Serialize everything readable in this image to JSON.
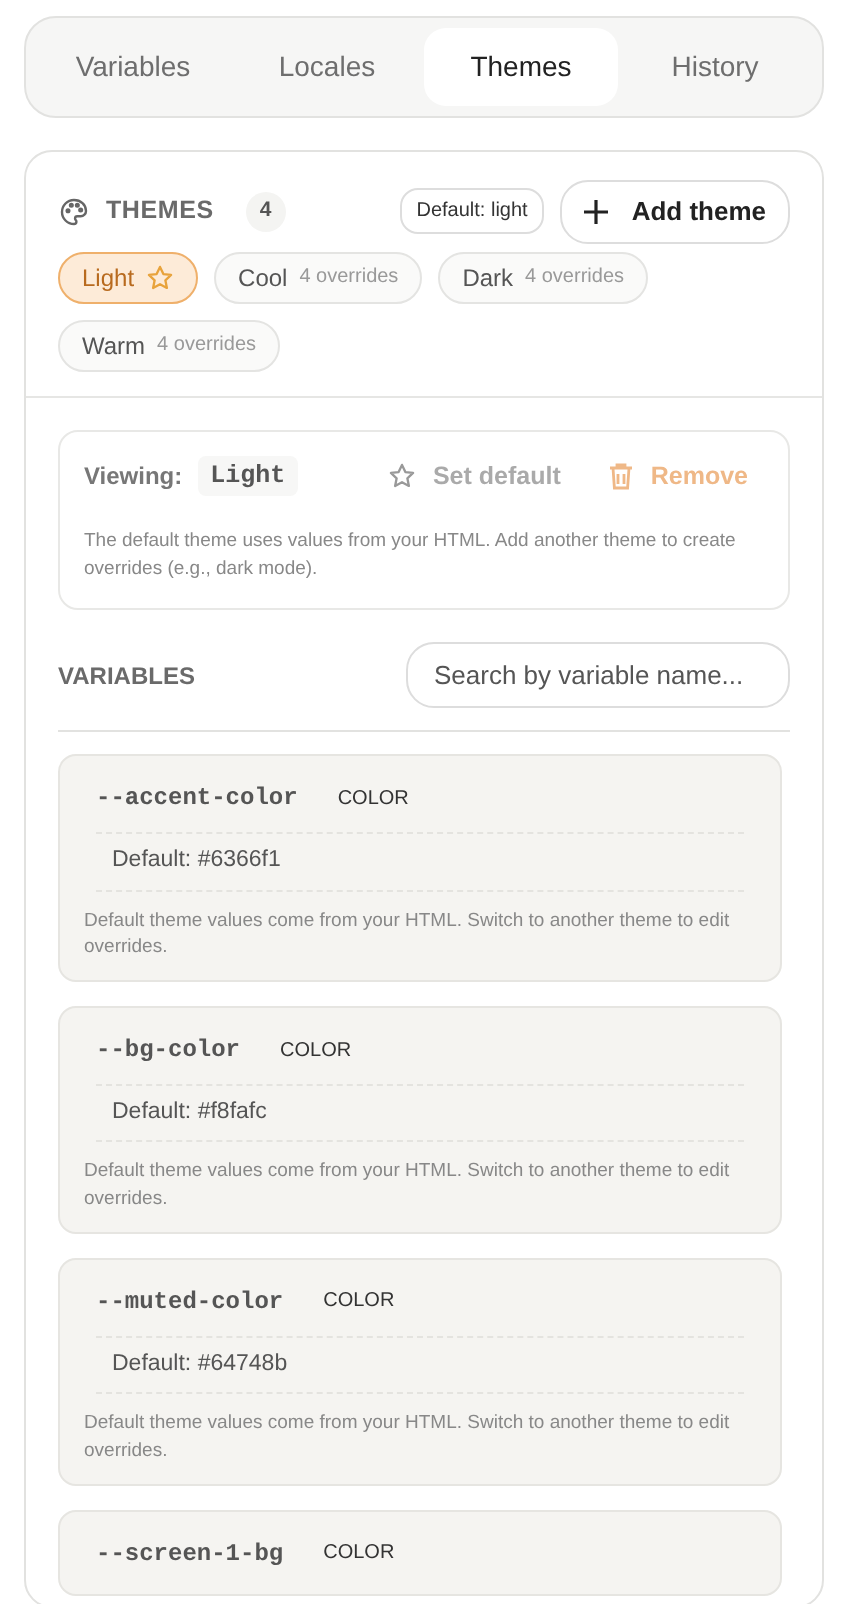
{
  "tabs": [
    {
      "label": "Variables",
      "selected": false
    },
    {
      "label": "Locales",
      "selected": false
    },
    {
      "label": "Themes",
      "selected": true
    },
    {
      "label": "History",
      "selected": false
    }
  ],
  "themes_header": {
    "title": "THEMES",
    "count": "4",
    "default_badge": "Default: light",
    "add_button": "Add theme"
  },
  "themes": [
    {
      "name": "Light",
      "is_default": true,
      "selected": true
    },
    {
      "name": "Cool",
      "overrides": "4 overrides",
      "is_default": false,
      "selected": false
    },
    {
      "name": "Dark",
      "overrides": "4 overrides",
      "is_default": false,
      "selected": false
    },
    {
      "name": "Warm",
      "overrides": "4 overrides",
      "is_default": false,
      "selected": false
    }
  ],
  "viewing": {
    "label": "Viewing:",
    "theme": "Light",
    "set_default": "Set default",
    "set_default_disabled": true,
    "remove": "Remove",
    "note": "The default theme uses values from your HTML. Add another theme to create overrides (e.g., dark mode)."
  },
  "variables": {
    "title": "VARIABLES",
    "search": {
      "placeholder": "Search by variable name..."
    },
    "items": [
      {
        "name": "--accent-color",
        "type": "COLOR",
        "default": "Default: #6366f1",
        "note": "Default theme values come from your HTML. Switch to another theme to edit overrides."
      },
      {
        "name": "--bg-color",
        "type": "COLOR",
        "default": "Default: #f8fafc",
        "note": "Default theme values come from your HTML. Switch to another theme to edit overrides."
      },
      {
        "name": "--muted-color",
        "type": "COLOR",
        "default": "Default: #64748b",
        "note": "Default theme values come from your HTML. Switch to another theme to edit overrides."
      },
      {
        "name": "--screen-1-bg",
        "type": "COLOR"
      }
    ]
  }
}
